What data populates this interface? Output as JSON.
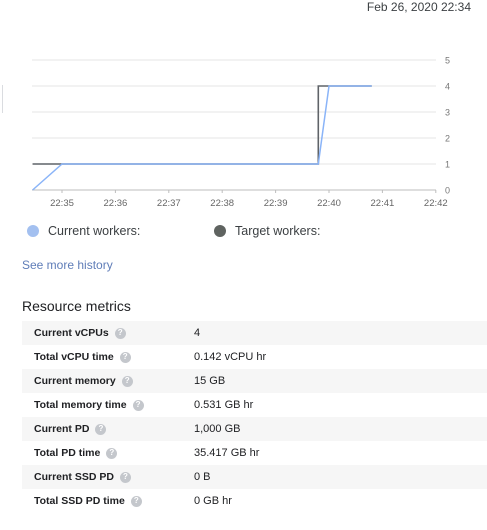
{
  "header": {
    "timestamp": "Feb 26, 2020 22:34"
  },
  "chart_data": {
    "type": "line",
    "x_ticks": [
      "22:35",
      "22:36",
      "22:37",
      "22:38",
      "22:39",
      "22:40",
      "22:41",
      "22:42"
    ],
    "y_ticks": [
      0,
      1,
      2,
      3,
      4,
      5
    ],
    "ylim": [
      0,
      5
    ],
    "series": [
      {
        "name": "Current workers:",
        "color": "#8ab4f8",
        "points": [
          [
            "22:34.45",
            0
          ],
          [
            "22:35",
            1
          ],
          [
            "22:39.8",
            1
          ],
          [
            "22:40",
            4
          ],
          [
            "22:40.8",
            4
          ]
        ]
      },
      {
        "name": "Target workers:",
        "color": "#5f6368",
        "points": [
          [
            "22:34.45",
            1
          ],
          [
            "22:39.8",
            1
          ],
          [
            "22:39.8",
            4
          ],
          [
            "22:40.8",
            4
          ]
        ]
      }
    ]
  },
  "legend": {
    "current_label": "Current workers:",
    "target_label": "Target workers:",
    "current_color": "#a3c0f0",
    "target_color": "#5f6360"
  },
  "links": {
    "see_more": "See more history"
  },
  "resource_metrics": {
    "title": "Resource metrics",
    "rows": [
      {
        "label": "Current vCPUs",
        "value": "4"
      },
      {
        "label": "Total vCPU time",
        "value": "0.142 vCPU hr"
      },
      {
        "label": "Current memory",
        "value": "15 GB"
      },
      {
        "label": "Total memory time",
        "value": "0.531 GB hr"
      },
      {
        "label": "Current PD",
        "value": "1,000 GB"
      },
      {
        "label": "Total PD time",
        "value": "35.417 GB hr"
      },
      {
        "label": "Current SSD PD",
        "value": "0 B"
      },
      {
        "label": "Total SSD PD time",
        "value": "0 GB hr"
      }
    ],
    "help_icon": "help-icon"
  }
}
